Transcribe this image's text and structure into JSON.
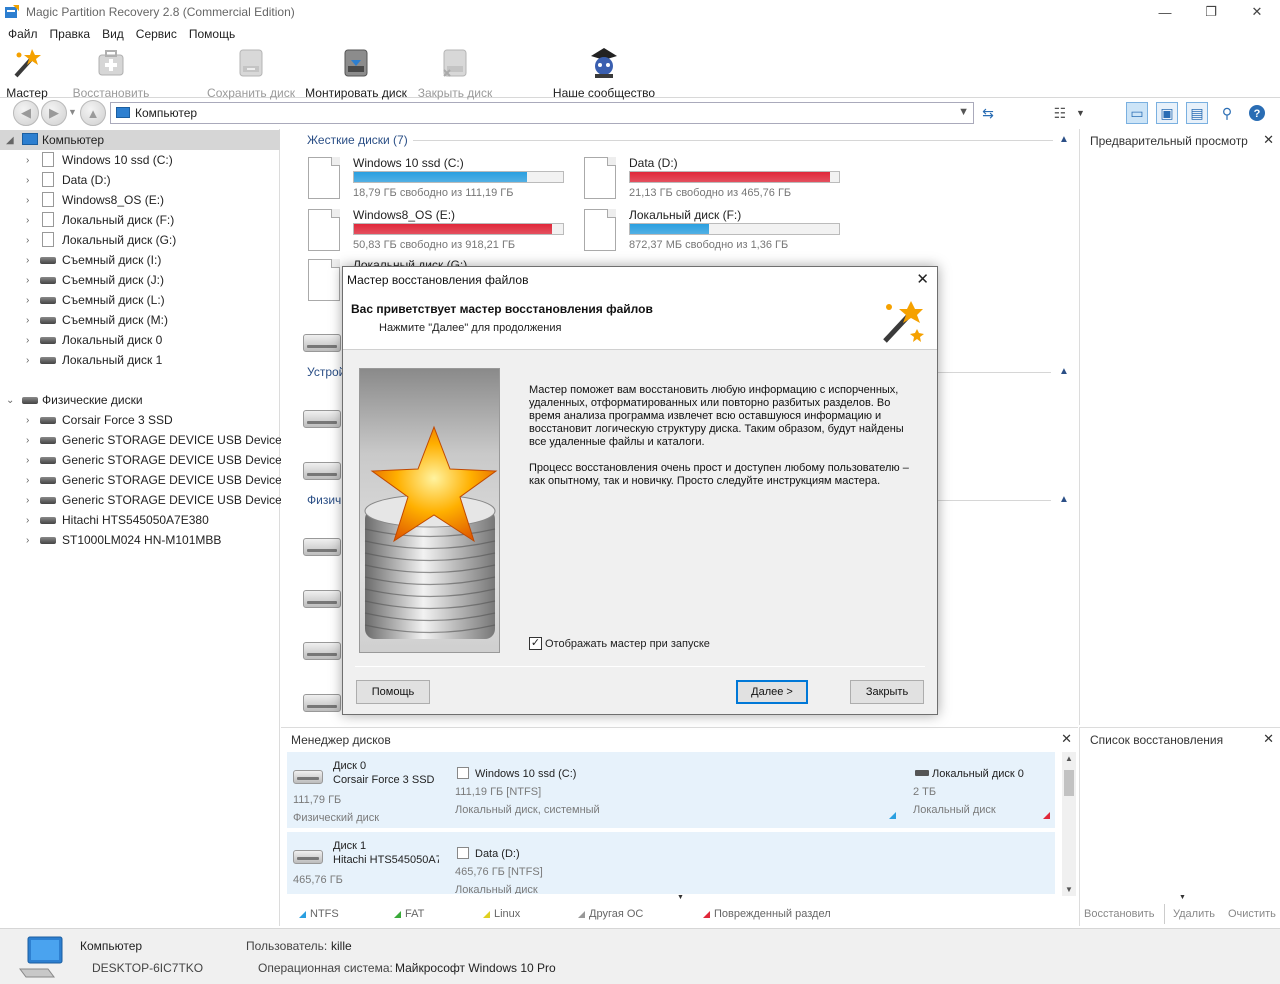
{
  "window": {
    "title": "Magic Partition Recovery 2.8 (Commercial Edition)",
    "minimize": "—",
    "maximize": "❐",
    "close": "✕"
  },
  "menu": [
    "Файл",
    "Правка",
    "Вид",
    "Сервис",
    "Помощь"
  ],
  "toolbar": {
    "wizard": "Мастер",
    "restore": "Восстановить",
    "save_disk": "Сохранить диск",
    "mount_disk": "Монтировать диск",
    "close_disk": "Закрыть диск",
    "community": "Наше сообщество"
  },
  "address": {
    "value": "Компьютер"
  },
  "tree": {
    "root": "Компьютер",
    "items": [
      "Windows 10 ssd (C:)",
      "Data (D:)",
      "Windows8_OS (E:)",
      "Локальный диск (F:)",
      "Локальный диск (G:)",
      "Съемный диск (I:)",
      "Съемный диск (J:)",
      "Съемный диск (L:)",
      "Съемный диск (M:)",
      "Локальный диск 0",
      "Локальный диск 1"
    ],
    "physical_root": "Физические диски",
    "physical": [
      "Corsair Force 3 SSD",
      "Generic STORAGE DEVICE USB Device",
      "Generic STORAGE DEVICE USB Device",
      "Generic STORAGE DEVICE USB Device",
      "Generic STORAGE DEVICE USB Device",
      "Hitachi HTS545050A7E380",
      "ST1000LM024 HN-M101MBB"
    ]
  },
  "center": {
    "hard_disks_header": "Жесткие диски (7)",
    "devices_header": "Устрой",
    "physical_header": "Физич",
    "disks": [
      {
        "name": "Windows 10 ssd (C:)",
        "free": "18,79 ГБ свободно из 111,19 ГБ",
        "used_fraction": 0.83,
        "color": "#2a9fe0"
      },
      {
        "name": "Data (D:)",
        "free": "21,13 ГБ свободно из 465,76 ГБ",
        "used_fraction": 0.955,
        "color": "#e0283a"
      },
      {
        "name": "Windows8_OS (E:)",
        "free": "50,83 ГБ свободно из 918,21 ГБ",
        "used_fraction": 0.945,
        "color": "#e0283a"
      },
      {
        "name": "Локальный диск (F:)",
        "free": "872,37 МБ свободно из 1,36 ГБ",
        "used_fraction": 0.38,
        "color": "#2a9fe0"
      }
    ],
    "partial_disk": "Локальный диск (G:)"
  },
  "preview": {
    "title": "Предварительный просмотр"
  },
  "diskmgr": {
    "title": "Менеджер дисков",
    "rows": [
      {
        "disk": "Диск 0",
        "model": "Corsair Force 3 SSD",
        "size": "111,79 ГБ",
        "kind": "Физический диск",
        "part1_name": "Windows 10 ssd (C:)",
        "part1_fs": "111,19 ГБ [NTFS]",
        "part1_type": "Локальный диск, системный",
        "part2_name": "Локальный диск 0",
        "part2_size": "2 ТБ",
        "part2_type": "Локальный диск"
      },
      {
        "disk": "Диск 1",
        "model": "Hitachi HTS545050A7",
        "size": "465,76 ГБ",
        "part1_name": "Data (D:)",
        "part1_fs": "465,76 ГБ [NTFS]",
        "part1_type": "Локальный диск"
      }
    ],
    "legend": [
      {
        "label": "NTFS",
        "color": "#2a9fe0"
      },
      {
        "label": "FAT",
        "color": "#3aaa3a"
      },
      {
        "label": "Linux",
        "color": "#e0d020"
      },
      {
        "label": "Другая ОС",
        "color": "#999999"
      },
      {
        "label": "Поврежденный раздел",
        "color": "#e0283a"
      }
    ]
  },
  "reclist": {
    "title": "Список восстановления",
    "restore": "Восстановить",
    "delete": "Удалить",
    "clear": "Очистить"
  },
  "status": {
    "computer_label": "Компьютер",
    "computer_name": "DESKTOP-6IC7TKO",
    "user_label": "Пользователь:",
    "user": "kille",
    "os_label": "Операционная система:",
    "os": "Майкрософт Windows 10 Pro"
  },
  "dialog": {
    "title": "Мастер восстановления файлов",
    "heading": "Вас приветствует мастер восстановления файлов",
    "subheading": "Нажмите \"Далее\" для продолжения",
    "para1": "Мастер поможет вам восстановить любую информацию с испорченных, удаленных, отформатированных или повторно разбитых разделов. Во время анализа программа извлечет всю оставшуюся информацию и восстановит логическую структуру диска. Таким образом, будут найдены все удаленные файлы и каталоги.",
    "para2": "Процесс восстановления очень прост и доступен любому пользователю – как опытному, так и новичку. Просто следуйте инструкциям мастера.",
    "checkbox": "Отображать мастер при запуске",
    "checked": "✓",
    "help_btn": "Помощь",
    "next_btn": "Далее >",
    "close_btn": "Закрыть"
  }
}
